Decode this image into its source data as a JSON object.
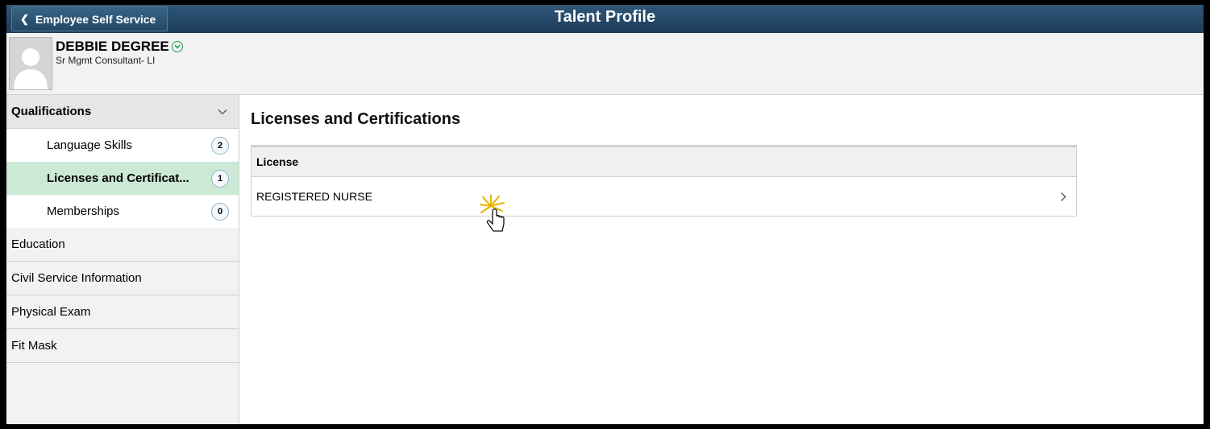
{
  "banner": {
    "back_label": "Employee Self Service",
    "title": "Talent Profile"
  },
  "person": {
    "name": "DEBBIE DEGREE",
    "job_title": "Sr Mgmt Consultant- LI"
  },
  "sidebar": {
    "group_label": "Qualifications",
    "sub_items": [
      {
        "label": "Language Skills",
        "count": "2"
      },
      {
        "label": "Licenses and Certificat...",
        "count": "1"
      },
      {
        "label": "Memberships",
        "count": "0"
      }
    ],
    "items": [
      "Education",
      "Civil Service Information",
      "Physical Exam",
      "Fit Mask"
    ]
  },
  "main": {
    "section_title": "Licenses and Certifications",
    "column_header": "License",
    "rows": [
      {
        "license": "REGISTERED NURSE"
      }
    ]
  },
  "colors": {
    "banner": "#1d3d5b",
    "active_item": "#cbe9d5",
    "accent_green": "#1e9c4a"
  }
}
